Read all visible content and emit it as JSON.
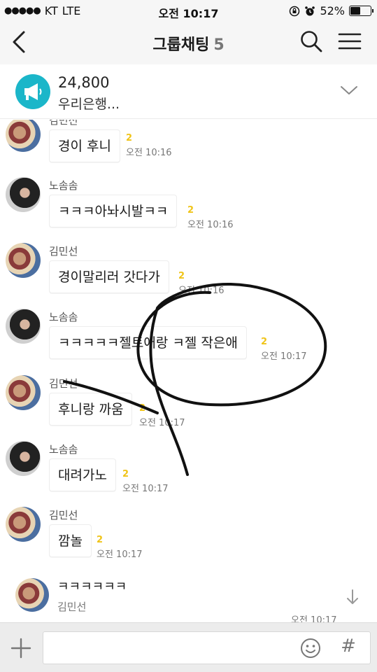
{
  "status_bar": {
    "carrier": "KT",
    "network": "LTE",
    "time": "오전 10:17",
    "battery_percent": "52%",
    "battery_level": 0.52
  },
  "header": {
    "title": "그룹채팅",
    "member_count": "5",
    "back_icon": "chevron-left-icon",
    "search_icon": "search-icon",
    "menu_icon": "hamburger-menu-icon"
  },
  "notice": {
    "icon": "megaphone-icon",
    "amount": "24,800",
    "text": "우리은행...",
    "expand_icon": "chevron-down-icon"
  },
  "messages": [
    {
      "sender": "김민선",
      "text": "경이 후니",
      "unread": "2",
      "time": "오전 10:16"
    },
    {
      "sender": "노솜솜",
      "text": "ㅋㅋㅋ아놔시발ㅋㅋ",
      "unread": "2",
      "time": "오전 10:16"
    },
    {
      "sender": "김민선",
      "text": "경이말리러 갓다가",
      "unread": "2",
      "time": "오전 10:16"
    },
    {
      "sender": "노솜솜",
      "text": "ㅋㅋㅋㅋㅋ젤트애랑 ㅋ젤 작은애",
      "unread": "2",
      "time": "오전 10:17"
    },
    {
      "sender": "김민선",
      "text": "후니랑 까움",
      "unread": "2",
      "time": "오전 10:17"
    },
    {
      "sender": "노솜솜",
      "text": "대려가노",
      "unread": "2",
      "time": "오전 10:17"
    },
    {
      "sender": "김민선",
      "text": "깜놀",
      "unread": "2",
      "time": "오전 10:17"
    }
  ],
  "latest_preview": {
    "text": "ㅋㅋㅋㅋㅋㅋ",
    "sender": "김민선",
    "time": "오전 10:17",
    "scroll_icon": "arrow-down-icon"
  },
  "input_bar": {
    "plus_icon": "plus-icon",
    "emoji_icon": "emoji-icon",
    "hash_label": "#"
  },
  "colors": {
    "notice_icon_bg": "#1bb6c9",
    "unread_count": "#f0c419",
    "header_bg": "#f6f6f6"
  }
}
